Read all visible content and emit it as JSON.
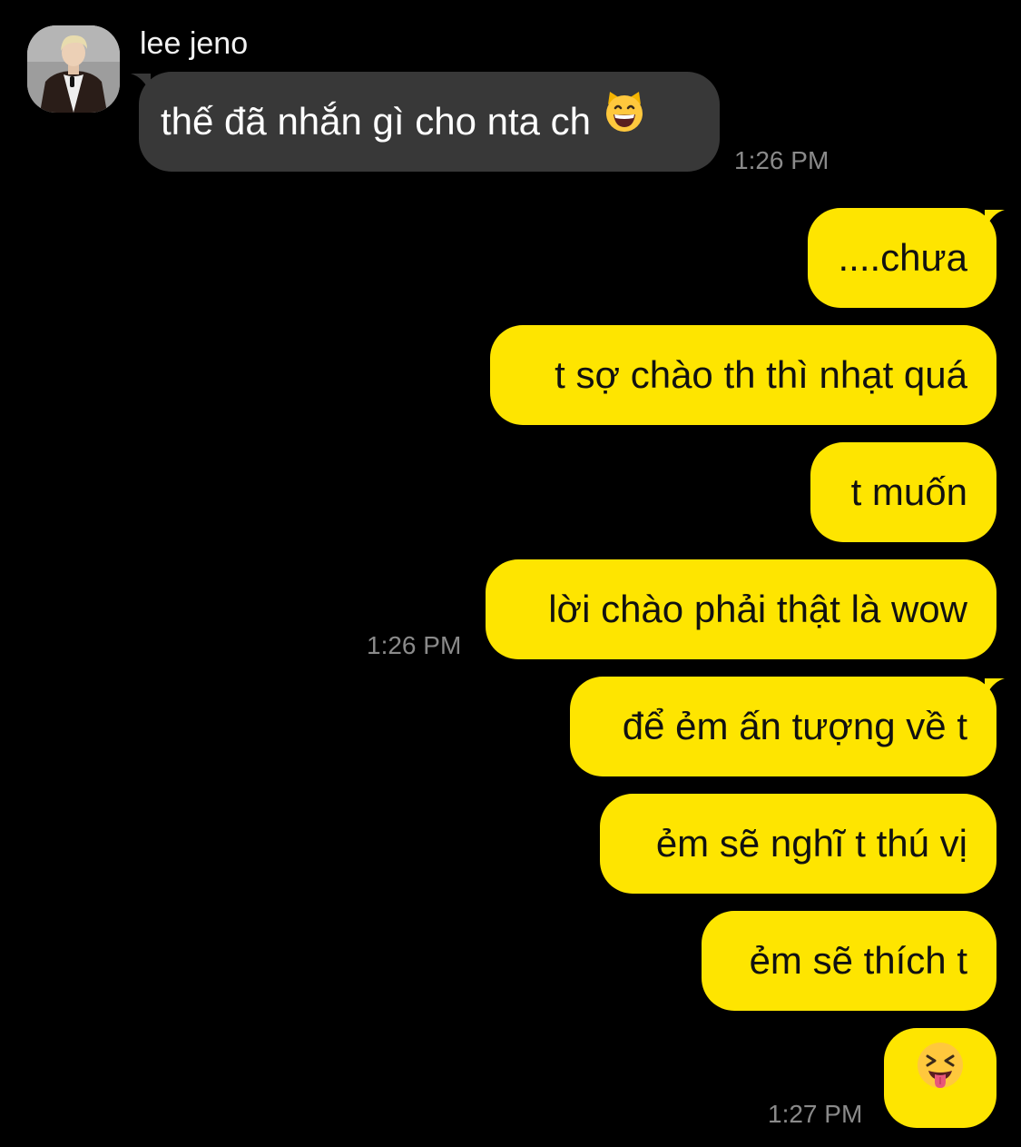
{
  "contact": {
    "name": "lee jeno",
    "avatar_icon": "profile-photo"
  },
  "colors": {
    "background": "#000000",
    "incoming_bubble": "#383838",
    "outgoing_bubble": "#FEE500",
    "timestamp": "#8a8a8a"
  },
  "messages": [
    {
      "direction": "in",
      "text": "thế đã nhắn gì cho nta ch",
      "emoji": "grinning-cat-face",
      "time": "1:26 PM"
    },
    {
      "direction": "out",
      "text": "....chưa"
    },
    {
      "direction": "out",
      "text": "t sợ chào th thì nhạt quá"
    },
    {
      "direction": "out",
      "text": "t muốn"
    },
    {
      "direction": "out",
      "text": "lời chào phải thật là wow",
      "time": "1:26 PM"
    },
    {
      "direction": "out",
      "text": "để ẻm ấn tượng về t"
    },
    {
      "direction": "out",
      "text": "ẻm sẽ nghĩ t thú vị"
    },
    {
      "direction": "out",
      "text": "ẻm sẽ thích t"
    },
    {
      "direction": "out",
      "text": "",
      "emoji": "squinting-face-with-tongue",
      "time": "1:27 PM"
    }
  ]
}
